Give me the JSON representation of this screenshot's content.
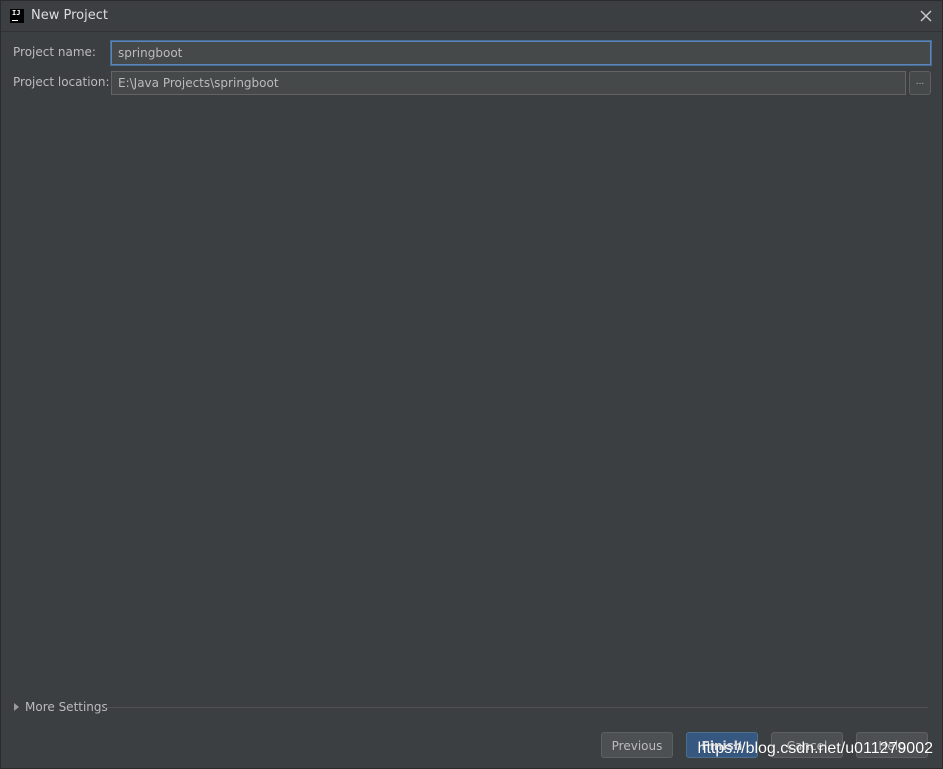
{
  "window": {
    "title": "New Project",
    "app_icon_text": "IJ"
  },
  "form": {
    "project_name_label": "Project name:",
    "project_name_value": "springboot",
    "project_location_label": "Project location:",
    "project_location_value": "E:\\Java Projects\\springboot",
    "browse_label": "..."
  },
  "more_settings": {
    "label": "More Settings"
  },
  "buttons": {
    "previous": "Previous",
    "finish": "Finish",
    "cancel": "Cancel",
    "help": "Help"
  },
  "watermark": "https://blog.csdn.net/u011279002",
  "colors": {
    "background": "#3c3f41",
    "input_background": "#45494a",
    "focus_border": "#5b84b8",
    "default_button": "#365880"
  },
  "icons": {
    "app": "intellij-icon",
    "close": "close-icon",
    "expand": "triangle-right-icon"
  }
}
